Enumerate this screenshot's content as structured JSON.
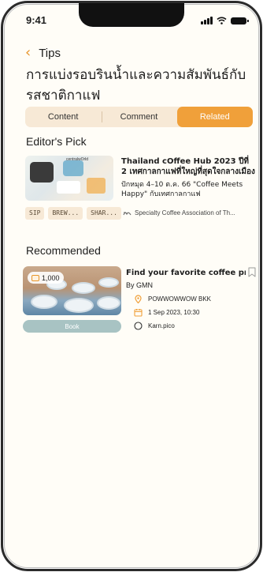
{
  "status_bar": {
    "time": "9:41"
  },
  "header": {
    "back_label": "Tips",
    "title": "การแบ่งรอบรินน้ำและความสัมพันธ์กับรสชาติกาแฟ"
  },
  "tabs": [
    {
      "label": "Content",
      "active": false
    },
    {
      "label": "Comment",
      "active": false
    },
    {
      "label": "Related",
      "active": true
    }
  ],
  "editors_pick": {
    "section_title": "Editor's Pick",
    "thumbnail_text": "centralwOrld",
    "title": "Thailand cOffee Hub 2023 ปีที่ 2 เทศกาลกาแฟที่ใหญ่ที่สุดใจกลางเมือง",
    "description": "ปักหมุด 4–10 ต.ค. 66 \"Coffee Meets Happy\" กับเทศกาลกาแฟ",
    "tags": [
      "SIP",
      "BREW...",
      "SHAR..."
    ],
    "source": "Specialty Coffee Association of Th..."
  },
  "recommended": {
    "section_title": "Recommended",
    "price": "1,000",
    "book_label": "Book",
    "title": "Find your favorite coffee profile",
    "by": "By GMN",
    "location": "POWWOWWOW BKK",
    "date": "1 Sep 2023, 10:30",
    "host": "Karn.pico"
  },
  "colors": {
    "accent": "#f0a03a",
    "tab_bg": "#f7e9d6",
    "book_button": "#a8c3c3",
    "background": "#fffdf7"
  }
}
